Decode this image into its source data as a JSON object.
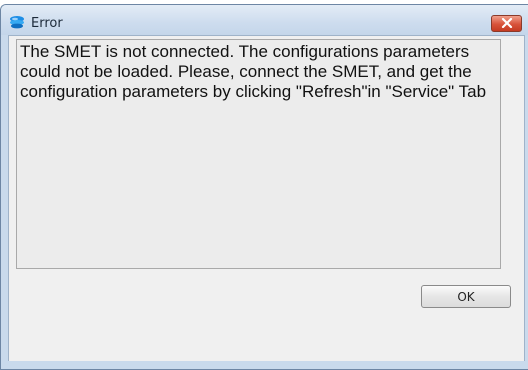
{
  "window": {
    "title": "Error",
    "app_icon": "swirl-app-icon",
    "close_icon": "close-icon"
  },
  "message": {
    "text": "The SMET is not connected. The configurations parameters could not be loaded. Please, connect the SMET, and get the configuration parameters by clicking \"Refresh\"in \"Service\" Tab"
  },
  "buttons": {
    "ok_label": "OK"
  }
}
